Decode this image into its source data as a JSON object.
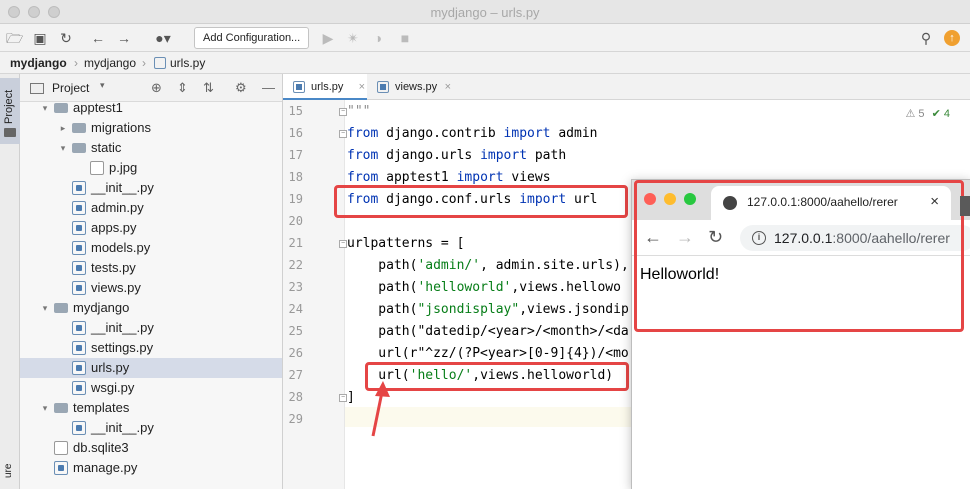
{
  "window": {
    "title": "mydjango – urls.py"
  },
  "toolbar": {
    "run_config_label": "Add Configuration..."
  },
  "breadcrumbs": [
    "mydjango",
    "mydjango",
    "urls.py"
  ],
  "left_strip": {
    "project_tab": "Project",
    "bottom_label": "ure"
  },
  "project_panel": {
    "header_label": "Project",
    "tree": [
      {
        "label": "apptest1",
        "type": "folder",
        "depth": 1,
        "expanded": true
      },
      {
        "label": "migrations",
        "type": "folder",
        "depth": 2,
        "expanded": false
      },
      {
        "label": "static",
        "type": "folder",
        "depth": 2,
        "expanded": true
      },
      {
        "label": "p.jpg",
        "type": "image",
        "depth": 3
      },
      {
        "label": "__init__.py",
        "type": "py",
        "depth": 2
      },
      {
        "label": "admin.py",
        "type": "py",
        "depth": 2
      },
      {
        "label": "apps.py",
        "type": "py",
        "depth": 2
      },
      {
        "label": "models.py",
        "type": "py",
        "depth": 2
      },
      {
        "label": "tests.py",
        "type": "py",
        "depth": 2
      },
      {
        "label": "views.py",
        "type": "py",
        "depth": 2
      },
      {
        "label": "mydjango",
        "type": "folder",
        "depth": 1,
        "expanded": true
      },
      {
        "label": "__init__.py",
        "type": "py",
        "depth": 2
      },
      {
        "label": "settings.py",
        "type": "py",
        "depth": 2
      },
      {
        "label": "urls.py",
        "type": "py",
        "depth": 2,
        "selected": true
      },
      {
        "label": "wsgi.py",
        "type": "py",
        "depth": 2
      },
      {
        "label": "templates",
        "type": "folder",
        "depth": 1,
        "expanded": true
      },
      {
        "label": "__init__.py",
        "type": "py",
        "depth": 2
      },
      {
        "label": "db.sqlite3",
        "type": "db",
        "depth": 1
      },
      {
        "label": "manage.py",
        "type": "py",
        "depth": 1
      }
    ]
  },
  "editor": {
    "tabs": [
      {
        "label": "urls.py",
        "active": true
      },
      {
        "label": "views.py",
        "active": false
      }
    ],
    "inspections": {
      "warnings": "5",
      "ok": "4"
    },
    "lines": [
      {
        "num": "15",
        "text": "\"\"\""
      },
      {
        "num": "16",
        "text": "from django.contrib import admin"
      },
      {
        "num": "17",
        "text": "from django.urls import path"
      },
      {
        "num": "18",
        "text": "from apptest1 import views"
      },
      {
        "num": "19",
        "text": "from django.conf.urls import url"
      },
      {
        "num": "20",
        "text": ""
      },
      {
        "num": "21",
        "text": "urlpatterns = ["
      },
      {
        "num": "22",
        "text": "    path('admin/', admin.site.urls),"
      },
      {
        "num": "23",
        "text": "    path('helloworld',views.hellowo"
      },
      {
        "num": "24",
        "text": "    path(\"jsondisplay\",views.jsondip"
      },
      {
        "num": "25",
        "text": "    path(\"datedip/<year>/<month>/<da"
      },
      {
        "num": "26",
        "text": "    url(r\"^zz/(?P<year>[0-9]{4})/<mo"
      },
      {
        "num": "27",
        "text": "    url('hello/',views.helloworld)"
      },
      {
        "num": "28",
        "text": "]"
      },
      {
        "num": "29",
        "text": ""
      }
    ]
  },
  "browser": {
    "tab_title": "127.0.0.1:8000/aahello/rerer",
    "url_host": "127.0.0.1",
    "url_rest": ":8000/aahello/rerer",
    "body_text": "Helloworld!",
    "info_icon": "i"
  },
  "colors": {
    "highlight_red": "#e54545",
    "selection": "#d5dbe8",
    "keyword": "#0033b3",
    "string": "#067d17"
  }
}
